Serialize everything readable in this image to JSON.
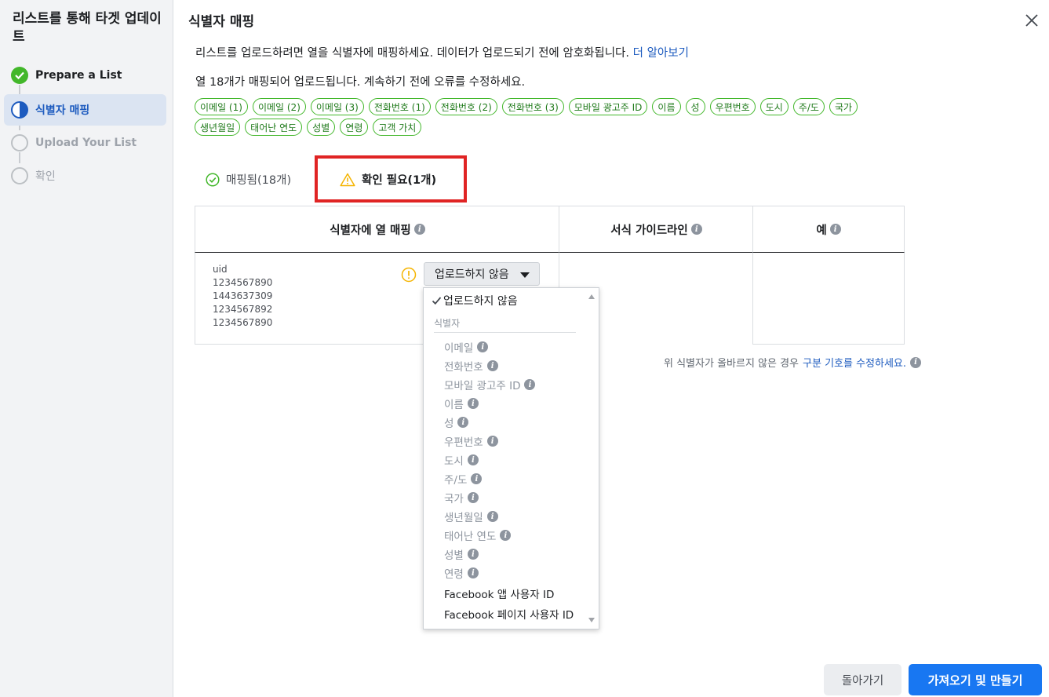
{
  "sidebar": {
    "title": "리스트를 통해 타겟 업데이트",
    "steps": [
      {
        "label": "Prepare a List",
        "state": "done"
      },
      {
        "label": "식별자 매핑",
        "state": "active"
      },
      {
        "label": "Upload Your List",
        "state": "pending"
      },
      {
        "label": "확인",
        "state": "pending"
      }
    ]
  },
  "main": {
    "title": "식별자 매핑",
    "description": "리스트를 업로드하려면 열을 식별자에 매핑하세요. 데이터가 업로드되기 전에 암호화됩니다.",
    "learn_more": "더 알아보기",
    "status_text": "열 18개가 매핑되어 업로드됩니다. 계속하기 전에 오류를 수정하세요.",
    "tags": [
      "이메일 (1)",
      "이메일 (2)",
      "이메일 (3)",
      "전화번호 (1)",
      "전화번호 (2)",
      "전화번호 (3)",
      "모바일 광고주 ID",
      "이름",
      "성",
      "우편번호",
      "도시",
      "주/도",
      "국가",
      "생년월일",
      "태어난 연도",
      "성별",
      "연령",
      "고객 가치"
    ]
  },
  "tabs": {
    "mapped": "매핑됨(18개)",
    "review": "확인 필요(1개)"
  },
  "table": {
    "headers": [
      "식별자에 열 매핑",
      "서식 가이드라인",
      "예"
    ],
    "row": {
      "column_name": "uid",
      "samples": [
        "1234567890",
        "1443637309",
        "1234567892",
        "1234567890"
      ],
      "select_value": "업로드하지 않음"
    }
  },
  "note": {
    "prefix": "위 식별자가 올바르지 않은 경우",
    "link": "구분 기호를 수정하세요."
  },
  "dropdown": {
    "selected": "업로드하지 않음",
    "section": "식별자",
    "items": [
      {
        "label": "이메일",
        "info": true,
        "enabled": false
      },
      {
        "label": "전화번호",
        "info": true,
        "enabled": false
      },
      {
        "label": "모바일 광고주 ID",
        "info": true,
        "enabled": false
      },
      {
        "label": "이름",
        "info": true,
        "enabled": false
      },
      {
        "label": "성",
        "info": true,
        "enabled": false
      },
      {
        "label": "우편번호",
        "info": true,
        "enabled": false
      },
      {
        "label": "도시",
        "info": true,
        "enabled": false
      },
      {
        "label": "주/도",
        "info": true,
        "enabled": false
      },
      {
        "label": "국가",
        "info": true,
        "enabled": false
      },
      {
        "label": "생년월일",
        "info": true,
        "enabled": false
      },
      {
        "label": "태어난 연도",
        "info": true,
        "enabled": false
      },
      {
        "label": "성별",
        "info": true,
        "enabled": false
      },
      {
        "label": "연령",
        "info": true,
        "enabled": false
      },
      {
        "label": "Facebook 앱 사용자 ID",
        "info": false,
        "enabled": true
      },
      {
        "label": "Facebook 페이지 사용자 ID",
        "info": false,
        "enabled": true
      }
    ]
  },
  "footer": {
    "back": "돌아가기",
    "primary": "가져오기 및 만들기"
  },
  "colors": {
    "primary": "#1877f2",
    "success": "#42b72a",
    "warning": "#f5b400",
    "highlight_frame": "#e02424"
  }
}
